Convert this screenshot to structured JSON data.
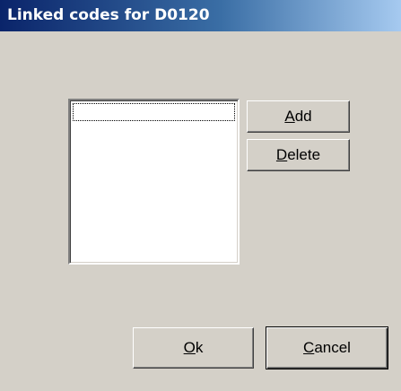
{
  "window": {
    "title": "Linked codes for D0120"
  },
  "linked_codes": {
    "items": []
  },
  "buttons": {
    "add": {
      "mnemonic": "A",
      "rest": "dd"
    },
    "delete": {
      "mnemonic": "D",
      "rest": "elete"
    },
    "ok": {
      "mnemonic": "O",
      "rest": "k"
    },
    "cancel": {
      "mnemonic": "C",
      "rest": "ancel"
    }
  },
  "colors": {
    "dialog_face": "#d4d0c8",
    "titlebar_start": "#0a246a",
    "titlebar_end": "#a6caf0",
    "title_text": "#ffffff"
  }
}
